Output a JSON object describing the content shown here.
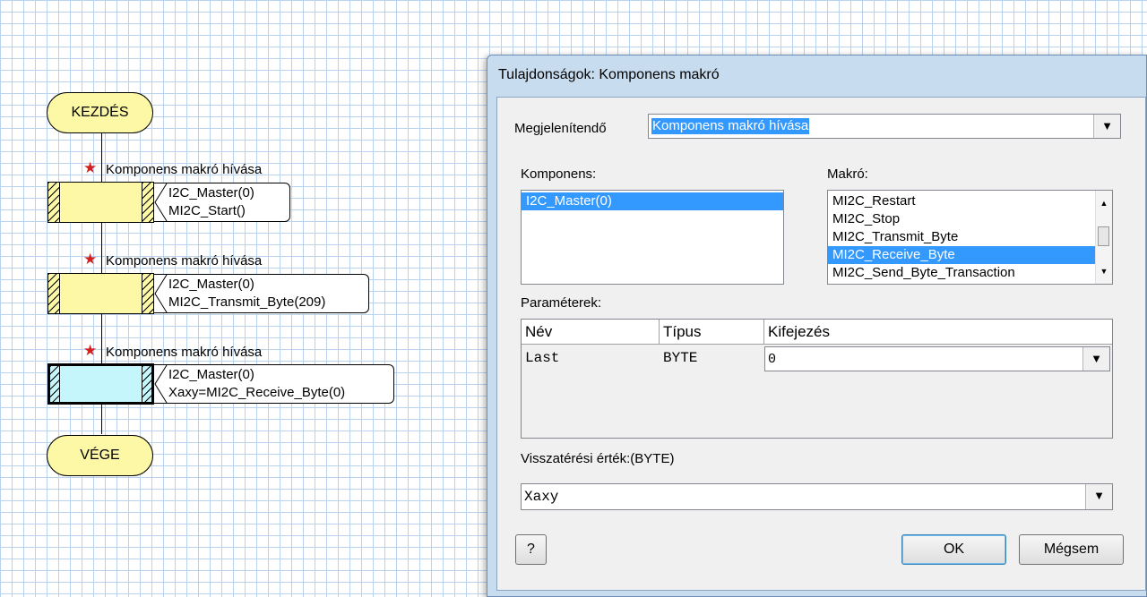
{
  "flowchart": {
    "start_label": "KEZDÉS",
    "end_label": "VÉGE",
    "blocks": [
      {
        "label": "Komponens makró hívása",
        "line1": "I2C_Master(0)",
        "line2": "MI2C_Start()",
        "active": false
      },
      {
        "label": "Komponens makró hívása",
        "line1": "I2C_Master(0)",
        "line2": "MI2C_Transmit_Byte(209)",
        "active": false
      },
      {
        "label": "Komponens makró hívása",
        "line1": "I2C_Master(0)",
        "line2": "Xaxy=MI2C_Receive_Byte(0)",
        "active": true
      }
    ]
  },
  "dialog": {
    "title": "Tulajdonságok: Komponens makró",
    "display_label": "Megjelenítendő",
    "display_value": "Komponens makró hívása",
    "component_label": "Komponens:",
    "components": [
      "I2C_Master(0)"
    ],
    "selected_component": "I2C_Master(0)",
    "macro_label": "Makró:",
    "macros": [
      "MI2C_Restart",
      "MI2C_Stop",
      "MI2C_Transmit_Byte",
      "MI2C_Receive_Byte",
      "MI2C_Send_Byte_Transaction"
    ],
    "selected_macro": "MI2C_Receive_Byte",
    "params_label": "Paraméterek:",
    "param_columns": [
      "Név",
      "Típus",
      "Kifejezés"
    ],
    "params": [
      {
        "name": "Last",
        "type": "BYTE",
        "expression": "0"
      }
    ],
    "return_label": "Visszatérési érték:(BYTE)",
    "return_value": "Xaxy",
    "help_button": "?",
    "ok_button": "OK",
    "cancel_button": "Mégsem"
  },
  "colors": {
    "block_fill": "#fdf8a6",
    "active_block_fill": "#c5f6fb",
    "selection": "#3399ff",
    "grid_line": "#b9d3ef",
    "star": "#d21f1f"
  },
  "icons": {
    "dropdown": "chevron-down-icon",
    "star": "star-icon"
  }
}
